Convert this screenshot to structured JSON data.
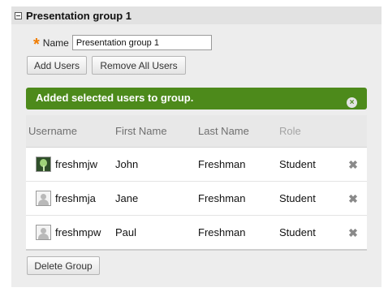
{
  "panel": {
    "title": "Presentation group 1",
    "name_label": "Name",
    "name_value": "Presentation group 1"
  },
  "buttons": {
    "add_users": "Add Users",
    "remove_all_users": "Remove All Users",
    "delete_group": "Delete Group"
  },
  "banner": {
    "message": "Added selected users to group.",
    "close_icon": "×",
    "color": "#4d8a1b"
  },
  "table": {
    "columns": [
      "Username",
      "First Name",
      "Last Name",
      "Role"
    ],
    "rows": [
      {
        "username": "freshmjw",
        "first_name": "John",
        "last_name": "Freshman",
        "role": "Student",
        "avatar": "custom-avatar-icon"
      },
      {
        "username": "freshmja",
        "first_name": "Jane",
        "last_name": "Freshman",
        "role": "Student",
        "avatar": "default-avatar-icon"
      },
      {
        "username": "freshmpw",
        "first_name": "Paul",
        "last_name": "Freshman",
        "role": "Student",
        "avatar": "default-avatar-icon"
      }
    ],
    "delete_icon": "✖"
  },
  "icons": {
    "collapse": "collapse-icon",
    "required": "*"
  }
}
